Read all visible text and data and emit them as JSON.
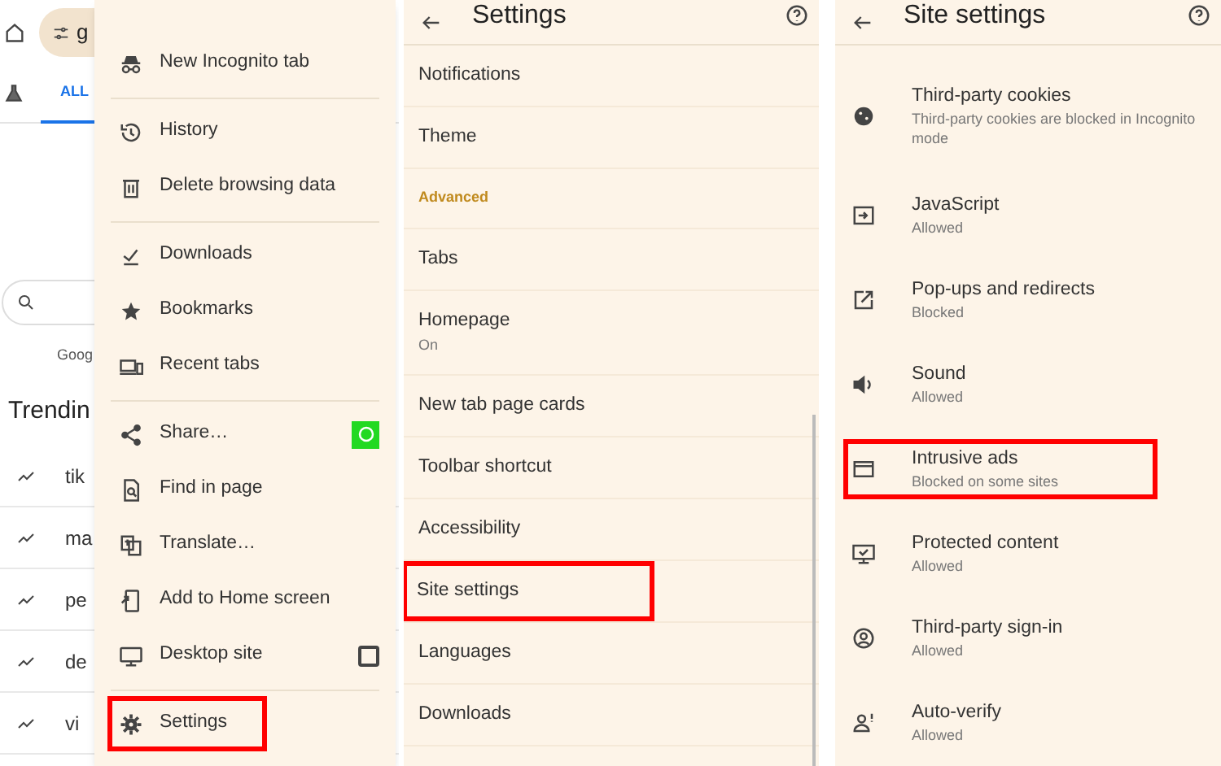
{
  "background_page": {
    "address": "g",
    "tabs": [
      {
        "label": "ALL",
        "selected": true
      }
    ],
    "footer_text": "Goog",
    "trending_title": "Trendin",
    "trending": [
      "tik",
      "ma",
      "pe",
      "de",
      "vi"
    ]
  },
  "menu": {
    "items": [
      {
        "kind": "item",
        "label": "New Incognito tab",
        "highlighted": false
      },
      {
        "kind": "divider"
      },
      {
        "kind": "item",
        "label": "History",
        "highlighted": false
      },
      {
        "kind": "item",
        "label": "Delete browsing data",
        "highlighted": false
      },
      {
        "kind": "divider"
      },
      {
        "kind": "item",
        "label": "Downloads",
        "highlighted": false
      },
      {
        "kind": "item",
        "label": "Bookmarks",
        "highlighted": false
      },
      {
        "kind": "item",
        "label": "Recent tabs",
        "highlighted": false
      },
      {
        "kind": "divider"
      },
      {
        "kind": "item",
        "label": "Share…",
        "highlighted": false
      },
      {
        "kind": "item",
        "label": "Find in page",
        "highlighted": false
      },
      {
        "kind": "item",
        "label": "Translate…",
        "highlighted": false
      },
      {
        "kind": "item",
        "label": "Add to Home screen",
        "highlighted": false
      },
      {
        "kind": "item",
        "label": "Desktop site",
        "checked": false,
        "highlighted": false
      },
      {
        "kind": "divider"
      },
      {
        "kind": "item",
        "label": "Settings",
        "highlighted": true
      }
    ]
  },
  "settings": {
    "title": "Settings",
    "items": [
      {
        "kind": "item",
        "label": "Notifications",
        "highlighted": false
      },
      {
        "kind": "item",
        "label": "Theme",
        "highlighted": false
      },
      {
        "kind": "section",
        "label": "Advanced"
      },
      {
        "kind": "item",
        "label": "Tabs",
        "highlighted": false
      },
      {
        "kind": "item",
        "label": "Homepage",
        "sublabel": "On",
        "highlighted": false
      },
      {
        "kind": "item",
        "label": "New tab page cards",
        "highlighted": false
      },
      {
        "kind": "item",
        "label": "Toolbar shortcut",
        "highlighted": false
      },
      {
        "kind": "item",
        "label": "Accessibility",
        "highlighted": false
      },
      {
        "kind": "item",
        "label": "Site settings",
        "highlighted": true
      },
      {
        "kind": "item",
        "label": "Languages",
        "highlighted": false
      },
      {
        "kind": "item",
        "label": "Downloads",
        "highlighted": false
      }
    ]
  },
  "site_settings": {
    "title": "Site settings",
    "items": [
      {
        "label": "Third-party cookies",
        "sublabel": "Third-party cookies are blocked in Incognito mode",
        "highlighted": false
      },
      {
        "label": "JavaScript",
        "sublabel": "Allowed",
        "highlighted": false
      },
      {
        "label": "Pop-ups and redirects",
        "sublabel": "Blocked",
        "highlighted": false
      },
      {
        "label": "Sound",
        "sublabel": "Allowed",
        "highlighted": false
      },
      {
        "label": "Intrusive ads",
        "sublabel": "Blocked on some sites",
        "highlighted": true
      },
      {
        "label": "Protected content",
        "sublabel": "Allowed",
        "highlighted": false
      },
      {
        "label": "Third-party sign-in",
        "sublabel": "Allowed",
        "highlighted": false
      },
      {
        "label": "Auto-verify",
        "sublabel": "Allowed",
        "highlighted": false
      }
    ]
  }
}
